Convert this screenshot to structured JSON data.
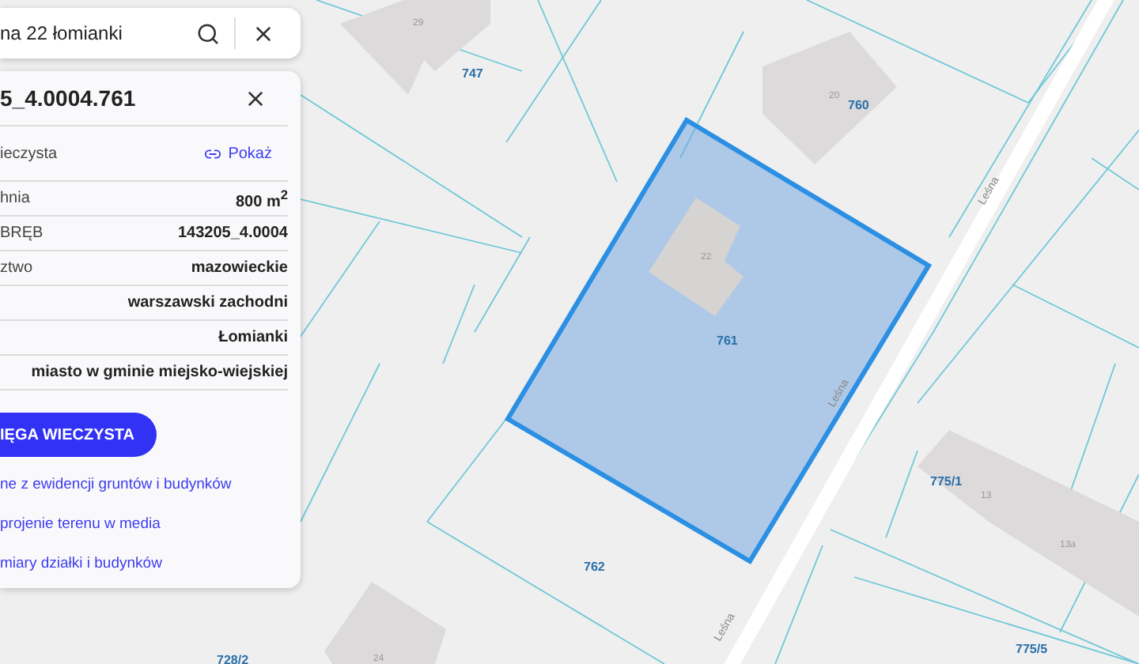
{
  "search": {
    "value": "na 22 łomianki"
  },
  "card": {
    "title": "5_4.0004.761",
    "rows": [
      {
        "kind": "link",
        "label": "ieczysta",
        "value": "Pokaż"
      },
      {
        "kind": "text",
        "label": "hnia",
        "value": "800 m$^{2}$"
      },
      {
        "kind": "text",
        "label": "BRĘB",
        "value": "143205_4.0004"
      },
      {
        "kind": "text",
        "label": "ztwo",
        "value": "mazowieckie"
      },
      {
        "kind": "text",
        "label": "",
        "value": "warszawski zachodni"
      },
      {
        "kind": "text",
        "label": "",
        "value": "Łomianki"
      },
      {
        "kind": "text",
        "label": "",
        "value": "miasto w gminie miejsko-wiejskiej"
      }
    ],
    "button": "IĘGA WIECZYSTA",
    "links": [
      "ne z ewidencji gruntów i budynków",
      "projenie terenu w media",
      "miary działki i budynków"
    ]
  },
  "map": {
    "parcels": [
      "747",
      "760",
      "761",
      "762",
      "775/1",
      "775/5",
      "728/2"
    ],
    "houses": [
      "29",
      "20",
      "22",
      "13",
      "13a",
      "24"
    ],
    "streets": [
      "Leśna",
      "Leśna",
      "Leśna"
    ]
  }
}
